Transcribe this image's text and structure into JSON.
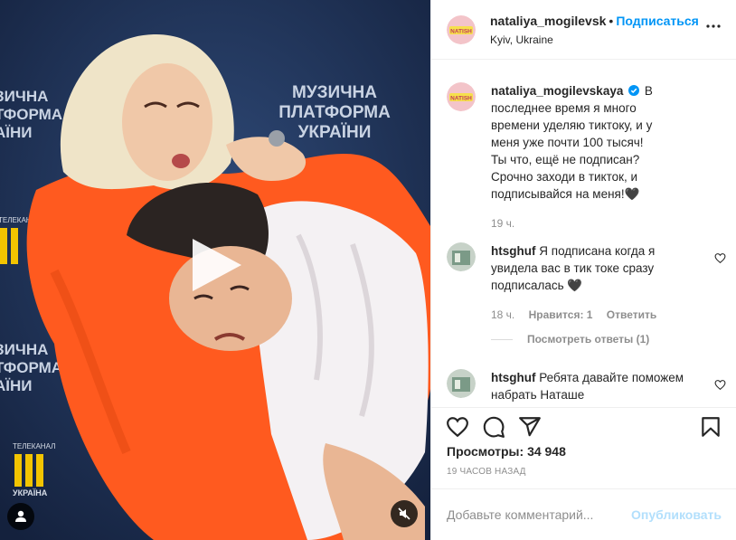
{
  "header": {
    "username": "nataliya_mogilevsk",
    "separator": "•",
    "follow_label": "Подписаться",
    "location": "Kyiv, Ukraine"
  },
  "avatar_text": "NATISH",
  "caption": {
    "username": "nataliya_mogilevskaya",
    "lines": [
      "В последнее время я много времени уделяю тиктоку, и у меня уже почти 100 тысяч!",
      "Ты что, ещё не подписан? Срочно заходи в тикток, и подписывайся на меня!🖤"
    ],
    "time": "19 ч."
  },
  "comments": [
    {
      "username": "htsghuf",
      "text": "Я подписана когда я увидела вас в тик токе сразу подписалась 🖤",
      "time": "18 ч.",
      "likes": "Нравится: 1",
      "reply_label": "Ответить",
      "view_replies": "Посмотреть ответы (1)"
    },
    {
      "username": "htsghuf",
      "text": "Ребята давайте поможем набрать Наташе"
    }
  ],
  "video": {
    "banner_line1": "МУЗИЧНА",
    "banner_line2": "ПЛАТФОРМА",
    "banner_line3": "УКРАЇНИ",
    "left_line1": "ЗИЧНА",
    "left_line2": "ТФОРМА",
    "left_line3": "АЇНИ",
    "lower_line1": "ЗИЧНА",
    "lower_line2": "ТФОРМА",
    "lower_line3": "АЇНИ",
    "tv_label": "ТЕЛЕКАНАЛ",
    "tv_name": "УКРАЇНА"
  },
  "stats": {
    "views_label": "Просмотры:",
    "views_value": "34 948",
    "posted": "19 ЧАСОВ НАЗАД"
  },
  "add_comment": {
    "placeholder": "Добавьте комментарий...",
    "publish_label": "Опубликовать"
  },
  "colors": {
    "accent": "#0095f6",
    "publish_disabled": "#b2dffc",
    "muted": "#8e8e8e",
    "coat": "#ff5a1f"
  },
  "icons": [
    "play-icon",
    "user-icon",
    "mute-icon",
    "more-icon",
    "verified-icon",
    "heart-icon",
    "comment-icon",
    "share-icon",
    "bookmark-icon"
  ]
}
